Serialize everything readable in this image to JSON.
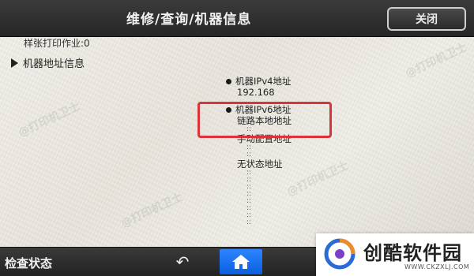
{
  "header": {
    "title": "维修/查询/机器信息",
    "close_label": "关闭"
  },
  "content": {
    "cut_line": "样张打印作业:0",
    "section_label": "机器地址信息",
    "ipv4": {
      "label": "机器IPv4地址",
      "value": "192.168"
    },
    "ipv6": {
      "label": "机器IPv6地址",
      "link_local": "链路本地地址",
      "manual": "手动配置地址",
      "stateless": "无状态地址"
    }
  },
  "footer": {
    "status_label": "检查状态"
  },
  "watermark": {
    "text": "@打印机卫士"
  },
  "logo": {
    "text": "创酷软件园",
    "url": "WWW.CKZXLJ.COM"
  },
  "colors": {
    "highlight": "#d8343a",
    "home_button": "#1a6ff0"
  }
}
